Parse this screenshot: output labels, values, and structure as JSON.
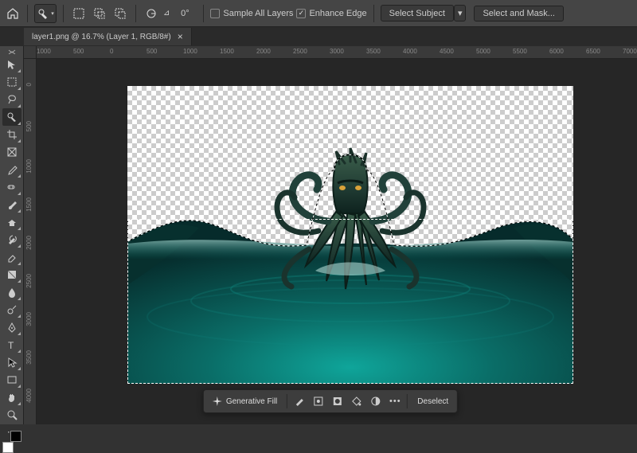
{
  "options_bar": {
    "angle": "0°",
    "sample_all_layers": {
      "label": "Sample All Layers",
      "checked": false
    },
    "enhance_edge": {
      "label": "Enhance Edge",
      "checked": true
    },
    "select_subject": "Select Subject",
    "select_and_mask": "Select and Mask..."
  },
  "document_tab": {
    "title": "layer1.png @ 16.7% (Layer 1, RGB/8#)"
  },
  "ruler": {
    "h_ticks": [
      "1000",
      "500",
      "0",
      "500",
      "1000",
      "1500",
      "2000",
      "2500",
      "3000",
      "3500",
      "4000",
      "4500",
      "5000",
      "5500",
      "6000",
      "6500",
      "7000"
    ],
    "v_ticks": [
      "0",
      "500",
      "1000",
      "1500",
      "2000",
      "2500",
      "3000",
      "3500",
      "4000"
    ]
  },
  "contextual_toolbar": {
    "generative_fill": "Generative Fill",
    "deselect": "Deselect"
  },
  "tools": [
    {
      "name": "move-tool",
      "sub": true
    },
    {
      "name": "rectangular-marquee-tool",
      "sub": true
    },
    {
      "name": "lasso-tool",
      "sub": true
    },
    {
      "name": "quick-selection-tool",
      "sub": true,
      "active": true
    },
    {
      "name": "crop-tool",
      "sub": true
    },
    {
      "name": "frame-tool",
      "sub": false
    },
    {
      "name": "eyedropper-tool",
      "sub": true
    },
    {
      "name": "spot-healing-tool",
      "sub": true
    },
    {
      "name": "brush-tool",
      "sub": true
    },
    {
      "name": "clone-stamp-tool",
      "sub": true
    },
    {
      "name": "history-brush-tool",
      "sub": true
    },
    {
      "name": "eraser-tool",
      "sub": true
    },
    {
      "name": "gradient-tool",
      "sub": true
    },
    {
      "name": "blur-tool",
      "sub": true
    },
    {
      "name": "dodge-tool",
      "sub": true
    },
    {
      "name": "pen-tool",
      "sub": true
    },
    {
      "name": "type-tool",
      "sub": true
    },
    {
      "name": "path-selection-tool",
      "sub": true
    },
    {
      "name": "rectangle-tool",
      "sub": true
    },
    {
      "name": "hand-tool",
      "sub": true
    },
    {
      "name": "zoom-tool",
      "sub": false
    }
  ],
  "colors": {
    "foreground": "#ffffff",
    "background": "#000000"
  }
}
